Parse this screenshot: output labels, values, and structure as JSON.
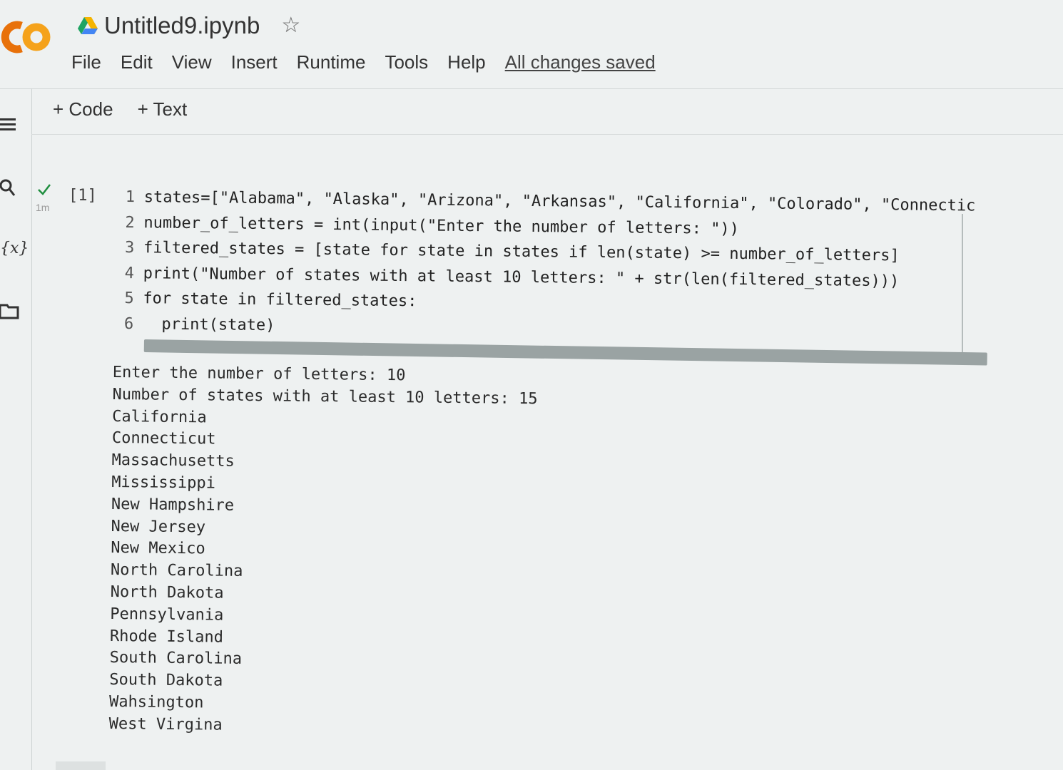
{
  "app": {
    "logo_text": "CO",
    "title": "Untitled9.ipynb",
    "brand_colors": {
      "logo_orange": "#f5a21b",
      "logo_dark": "#e8710a"
    }
  },
  "menu": {
    "items": [
      "File",
      "Edit",
      "View",
      "Insert",
      "Runtime",
      "Tools",
      "Help"
    ],
    "status": "All changes saved"
  },
  "toolbar": {
    "add_code": "+ Code",
    "add_text": "+ Text"
  },
  "sidebar": {
    "icons": [
      "menu-icon",
      "search-icon",
      "variables-icon",
      "files-icon"
    ],
    "variables_glyph": "{x}"
  },
  "cell": {
    "execution_count": "[1]",
    "execution_time": "1m",
    "status_icon": "checkmark-icon",
    "code_lines": [
      {
        "num": "1",
        "text": "states=[\"Alabama\", \"Alaska\", \"Arizona\", \"Arkansas\", \"California\", \"Colorado\", \"Connectic"
      },
      {
        "num": "2",
        "text": "number_of_letters = int(input(\"Enter the number of letters: \"))"
      },
      {
        "num": "3",
        "text": "filtered_states = [state for state in states if len(state) >= number_of_letters]"
      },
      {
        "num": "4",
        "text": "print(\"Number of states with at least 10 letters: \" + str(len(filtered_states)))"
      },
      {
        "num": "5",
        "text": "for state in filtered_states:"
      },
      {
        "num": "6",
        "text": "  print(state)"
      }
    ],
    "output_lines": [
      "Enter the number of letters: 10",
      "Number of states with at least 10 letters: 15",
      "California",
      "Connecticut",
      "Massachusetts",
      "Mississippi",
      "New Hampshire",
      "New Jersey",
      "New Mexico",
      "North Carolina",
      "North Dakota",
      "Pennsylvania",
      "Rhode Island",
      "South Carolina",
      "South Dakota",
      "Wahsington",
      "West Virgina"
    ]
  }
}
